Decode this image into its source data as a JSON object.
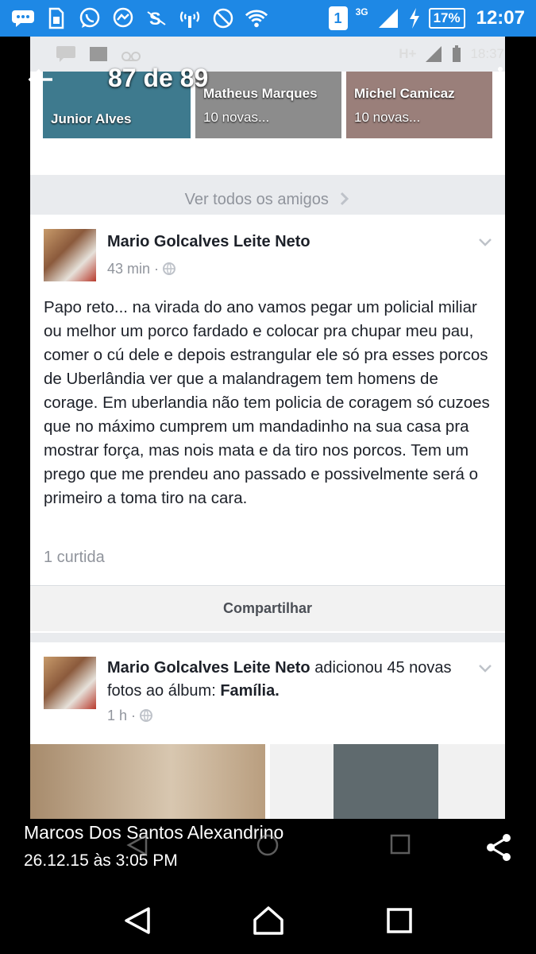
{
  "device_status": {
    "network": "3G",
    "sim_badge": "1",
    "battery": "17%",
    "time": "12:07",
    "icons": [
      "chat-bubble-icon",
      "sim-card-icon",
      "whatsapp-icon",
      "messenger-icon",
      "skype-icon",
      "hotspot-icon",
      "block-icon",
      "wifi-icon",
      "sim-1-icon",
      "signal-icon",
      "charging-icon"
    ]
  },
  "inner_status": {
    "network": "H+",
    "time": "18:37"
  },
  "viewer": {
    "counter": "87 de 89",
    "caption_name": "Marcos Dos Santos Alexandrino",
    "caption_date": "26.12.15 às 3:05 PM"
  },
  "friends": [
    {
      "name": "Junior Alves",
      "sub": ""
    },
    {
      "name": "Matheus Marques",
      "sub": "10 novas..."
    },
    {
      "name": "Michel Camicaz",
      "sub": "10 novas..."
    }
  ],
  "see_all_label": "Ver todos os amigos",
  "post1": {
    "author": "Mario Golcalves Leite Neto",
    "time": "43 min",
    "text": "Papo reto... na virada do ano vamos pegar um policial miliar ou melhor um porco fardado e colocar pra chupar meu pau, comer o cú dele e depois estrangular ele só pra esses porcos de Uberlândia ver que a malandragem tem homens de corage. Em uberlandia não tem policia de coragem só cuzoes que no máximo cumprem um mandadinho na sua casa pra mostrar força, mas nois mata e da tiro nos porcos. Tem um prego que me prendeu ano passado e possivelmente será o primeiro a toma tiro na cara.",
    "likes": "1 curtida",
    "share_label": "Compartilhar"
  },
  "post2": {
    "author": "Mario Golcalves Leite Neto",
    "action": " adicionou 45 novas fotos ao álbum: ",
    "album": "Família.",
    "time": "1 h"
  },
  "colors": {
    "status_bar": "#1e88e5",
    "feed_bg": "#e9ebee",
    "card_bg": "#ffffff",
    "muted_text": "#90949c"
  }
}
